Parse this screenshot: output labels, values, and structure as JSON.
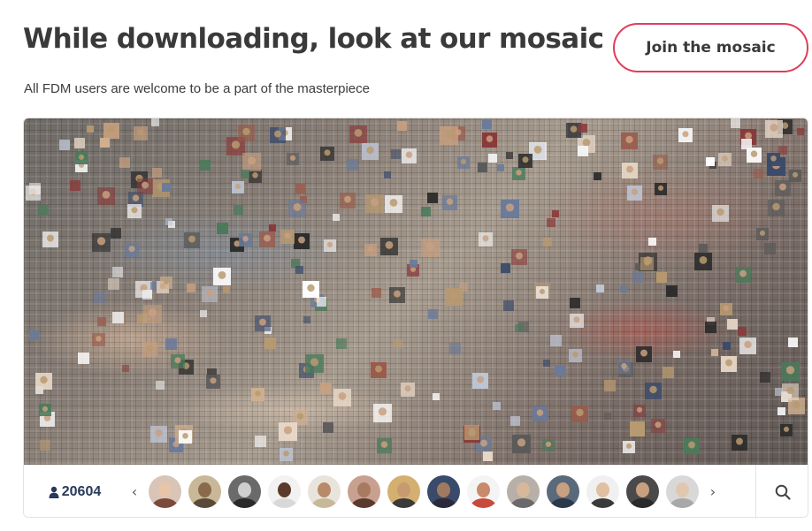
{
  "header": {
    "title": "While downloading, look at our mosaic",
    "subtitle": "All FDM users are welcome to be a part of the masterpiece",
    "join_label": "Join the mosaic"
  },
  "colors": {
    "accent": "#e23b5b",
    "count_text": "#273a5a",
    "heading_text": "#3a3a3a"
  },
  "mosaic": {
    "label": ""
  },
  "bar": {
    "participants_count": "20604",
    "user_icon": "user-icon",
    "prev_arrow": "‹",
    "next_arrow": "›",
    "search_icon": "search-icon",
    "avatars": [
      {
        "bg": "#d9c4b8",
        "skin": "#e8c4a8",
        "shirt": "#7a4a3a"
      },
      {
        "bg": "#c8b898",
        "skin": "#8a6a4a",
        "shirt": "#5a4a3a"
      },
      {
        "bg": "#6a6a6a",
        "skin": "#cfcfcf",
        "shirt": "#2a2a2a"
      },
      {
        "bg": "#f2f2f2",
        "skin": "#5a3a2a",
        "shirt": "#d8d8d8"
      },
      {
        "bg": "#e8e4dc",
        "skin": "#b88a6a",
        "shirt": "#c8b89a"
      },
      {
        "bg": "#c8a090",
        "skin": "#a87a60",
        "shirt": "#5a3a30"
      },
      {
        "bg": "#d4b070",
        "skin": "#c89a70",
        "shirt": "#3a3a3a"
      },
      {
        "bg": "#3a4a6a",
        "skin": "#a07a60",
        "shirt": "#2a2a3a"
      },
      {
        "bg": "#f4f4f4",
        "skin": "#c88a6a",
        "shirt": "#c84a3a"
      },
      {
        "bg": "#b8b0a8",
        "skin": "#d8b89a",
        "shirt": "#6a6a6a"
      },
      {
        "bg": "#5a6a7a",
        "skin": "#c8a080",
        "shirt": "#2a3a4a"
      },
      {
        "bg": "#f0f0f0",
        "skin": "#e0c0a0",
        "shirt": "#3a3a3a"
      },
      {
        "bg": "#4a4a4a",
        "skin": "#c8a080",
        "shirt": "#2a2a2a"
      },
      {
        "bg": "#d8d8d8",
        "skin": "#e0c8b0",
        "shirt": "#a8a8a8"
      }
    ]
  }
}
